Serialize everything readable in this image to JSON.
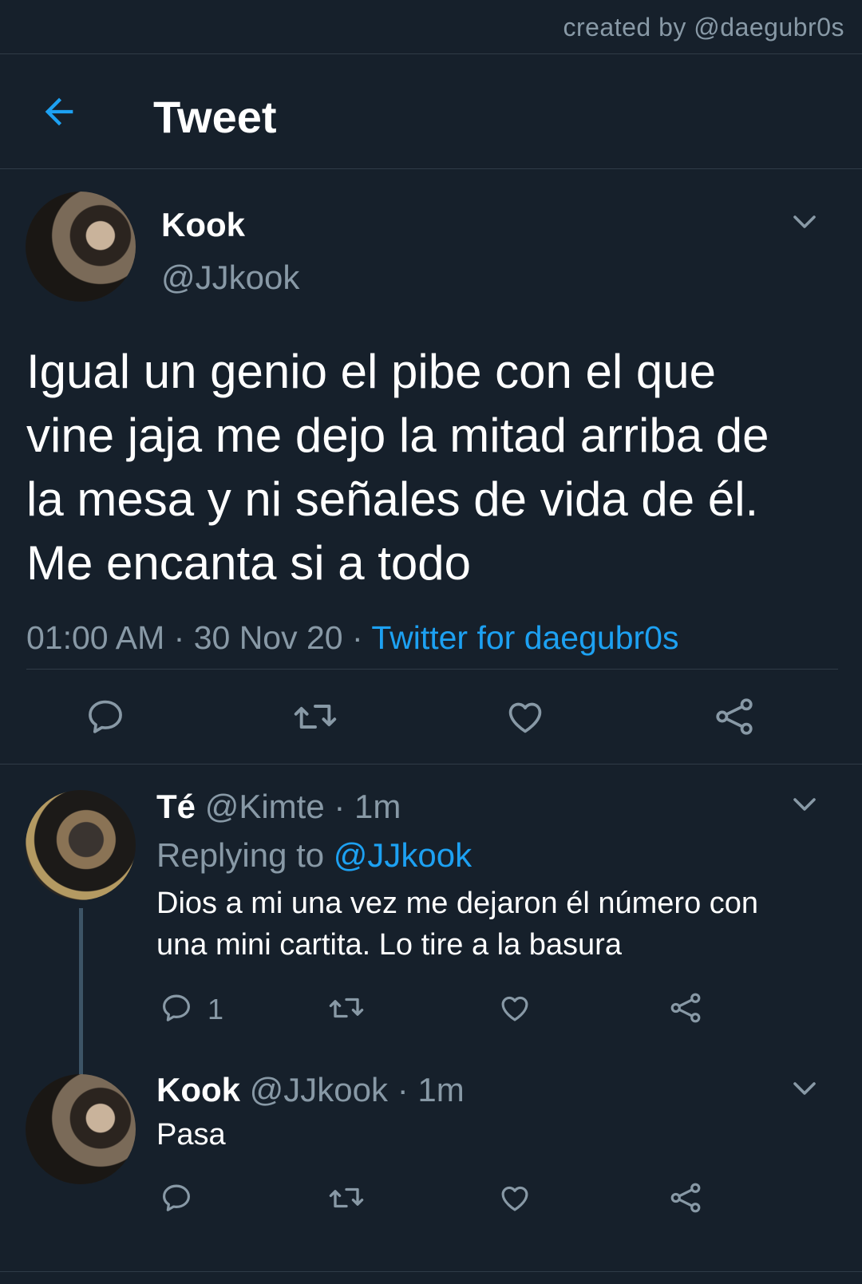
{
  "credit": "created by @daegubr0s",
  "header": {
    "title": "Tweet",
    "back_icon": "arrow-left-icon"
  },
  "tweet": {
    "author_name": "Kook",
    "author_handle": "@JJkook",
    "text_lines": [
      "Igual un genio el pibe con el que",
      "vine jaja me dejo la mitad arriba de",
      "la mesa y ni señales de vida de él.",
      "Me encanta si a todo"
    ],
    "time": "01:00 AM",
    "date": "30 Nov 20",
    "separator": "·",
    "source": "Twitter for daegubr0s"
  },
  "replies": [
    {
      "name": "Té",
      "handle": "@Kimte",
      "age": "1m",
      "replying_label": "Replying to",
      "replying_to": "@JJkook",
      "text_lines": [
        "Dios a mi una vez me dejaron él número con",
        "una mini cartita. Lo tire a la basura"
      ],
      "reply_count": "1"
    },
    {
      "name": "Kook",
      "handle": "@JJkook",
      "age": "1m",
      "text_lines": [
        "Pasa"
      ]
    }
  ],
  "colors": {
    "background": "#16202b",
    "accent": "#1da1f2",
    "muted": "#8899a6",
    "divider": "#2f3b47"
  },
  "icons": [
    "arrow-left-icon",
    "chevron-down-icon",
    "reply-icon",
    "retweet-icon",
    "like-icon",
    "share-icon"
  ]
}
